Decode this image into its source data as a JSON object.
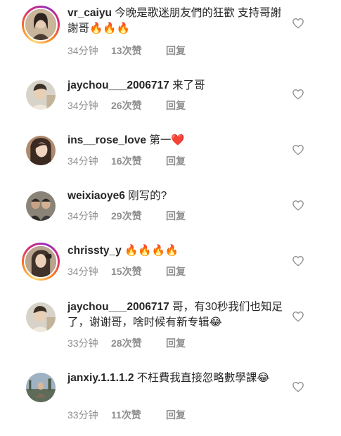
{
  "comments": [
    {
      "username": "vr_caiyu",
      "text": " 今晚是歌迷朋友們的狂歡 支持哥謝謝哥🔥🔥🔥",
      "time": "34分钟",
      "likes": "13次赞",
      "reply": "回复",
      "avatar_ring": true,
      "avatar_colors": [
        "#c9b59a",
        "#4a3b33"
      ]
    },
    {
      "username": "jaychou___2006717",
      "text": " 来了哥",
      "time": "34分钟",
      "likes": "26次赞",
      "reply": "回复",
      "avatar_ring": false,
      "avatar_colors": [
        "#d8d3c8",
        "#3b3026"
      ]
    },
    {
      "username": "ins__rose_love",
      "text": " 第一❤️",
      "time": "34分钟",
      "likes": "16次赞",
      "reply": "回复",
      "avatar_ring": false,
      "avatar_colors": [
        "#b08a6e",
        "#3a2a22"
      ]
    },
    {
      "username": "weixiaoye6",
      "text": " 刚写的?",
      "time": "34分钟",
      "likes": "29次赞",
      "reply": "回复",
      "avatar_ring": false,
      "avatar_colors": [
        "#8a8378",
        "#2d2a27"
      ]
    },
    {
      "username": "chrissty_y",
      "text": " 🔥🔥🔥🔥",
      "time": "34分钟",
      "likes": "15次赞",
      "reply": "回复",
      "avatar_ring": true,
      "avatar_colors": [
        "#b9a58f",
        "#3f332b"
      ]
    },
    {
      "username": "jaychou___2006717",
      "text": " 哥，有30秒我们也知足了，谢谢哥，啥时候有新专辑😂",
      "time": "33分钟",
      "likes": "28次赞",
      "reply": "回复",
      "avatar_ring": false,
      "avatar_colors": [
        "#d8d3c8",
        "#3b3026"
      ]
    },
    {
      "username": "janxiy.1.1.1.2",
      "text": " 不枉費我直接忽略數學課😂",
      "time": "33分钟",
      "likes": "11次赞",
      "reply": "回复",
      "avatar_ring": false,
      "avatar_colors": [
        "#9fb2c2",
        "#5d6b58"
      ]
    }
  ]
}
